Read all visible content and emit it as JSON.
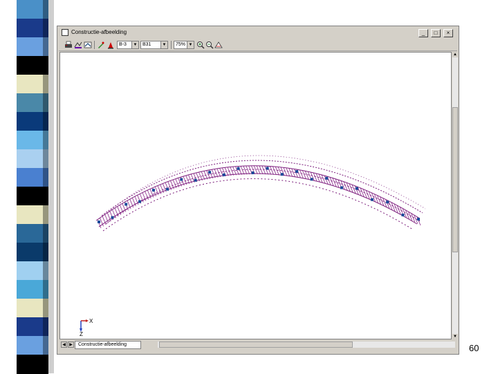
{
  "slide": {
    "page_number": "60"
  },
  "stripe_colors": [
    "#4a90c8",
    "#1a3a8a",
    "#6aa0e0",
    "#000000",
    "#e8e6c0",
    "#4a88a8",
    "#0a3a7a",
    "#6ab8e8",
    "#aad0f0",
    "#4a80d0",
    "#000000",
    "#e8e6c0",
    "#2a6898",
    "#0a3a6a",
    "#a0d0f0",
    "#4aa8d8",
    "#e8e6c0",
    "#1a3a8a",
    "#6aa0e0",
    "#000000"
  ],
  "window": {
    "title": "Constructie-afbeelding",
    "buttons": {
      "minimize": "_",
      "restore": "□",
      "close": "×"
    }
  },
  "toolbar": {
    "combo_1": "B-3",
    "combo_2": "B31",
    "zoom": "75%"
  },
  "canvas": {
    "axis_x_label": "X",
    "axis_z_label": "Z"
  },
  "bottom": {
    "sheet_tab": "Constructie-afbeelding"
  }
}
